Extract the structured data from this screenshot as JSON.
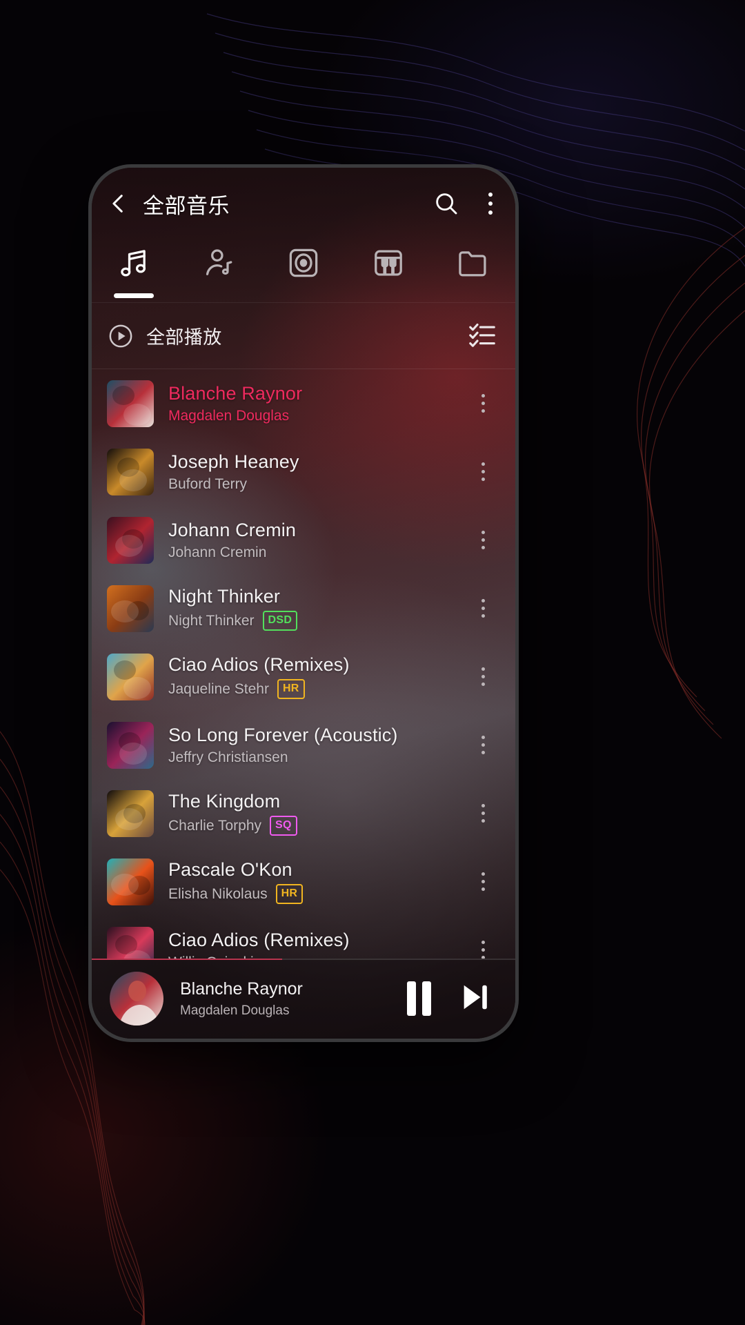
{
  "header": {
    "title": "全部音乐",
    "back_icon": "chevron-left-icon",
    "search_icon": "search-icon",
    "overflow_icon": "overflow-menu-icon"
  },
  "tabs": [
    {
      "name": "songs",
      "icon": "music-note-icon",
      "active": true
    },
    {
      "name": "artists",
      "icon": "artist-icon",
      "active": false
    },
    {
      "name": "albums",
      "icon": "album-disc-icon",
      "active": false
    },
    {
      "name": "genres",
      "icon": "piano-icon",
      "active": false
    },
    {
      "name": "folders",
      "icon": "folder-icon",
      "active": false
    }
  ],
  "play_all": {
    "label": "全部播放",
    "play_icon": "play-circle-icon",
    "multiselect_icon": "checklist-icon"
  },
  "songs": [
    {
      "title": "Blanche Raynor",
      "artist": "Magdalen Douglas",
      "badge": "",
      "playing": true,
      "art": [
        "#1d4f66",
        "#b8303a",
        "#e8e2dc"
      ]
    },
    {
      "title": "Joseph Heaney",
      "artist": "Buford Terry",
      "badge": "",
      "playing": false,
      "art": [
        "#120d0b",
        "#c98a2a",
        "#3a2410"
      ]
    },
    {
      "title": "Johann Cremin",
      "artist": "Johann Cremin",
      "badge": "",
      "playing": false,
      "art": [
        "#3a1020",
        "#b02430",
        "#1e2a58"
      ]
    },
    {
      "title": "Night Thinker",
      "artist": "Night Thinker",
      "badge": "DSD",
      "playing": false,
      "art": [
        "#d2701f",
        "#8a3c14",
        "#2a3a52"
      ]
    },
    {
      "title": "Ciao Adios (Remixes)",
      "artist": "Jaqueline Stehr",
      "badge": "HR",
      "playing": false,
      "art": [
        "#4fa8c8",
        "#e0a44a",
        "#8e2a26"
      ]
    },
    {
      "title": "So Long Forever (Acoustic)",
      "artist": "Jeffry Christiansen",
      "badge": "",
      "playing": false,
      "art": [
        "#1a1030",
        "#9a2458",
        "#2c6a8a"
      ]
    },
    {
      "title": "The Kingdom",
      "artist": "Charlie Torphy",
      "badge": "SQ",
      "playing": false,
      "art": [
        "#0e0a0c",
        "#d8a23a",
        "#6a4a40"
      ]
    },
    {
      "title": "Pascale O'Kon",
      "artist": "Elisha Nikolaus",
      "badge": "HR",
      "playing": false,
      "art": [
        "#20b0b8",
        "#e8521a",
        "#3a1008"
      ]
    },
    {
      "title": "Ciao Adios (Remixes)",
      "artist": "Willis Osinski",
      "badge": "",
      "playing": false,
      "art": [
        "#2a1020",
        "#d83a5a",
        "#1a2a4a"
      ]
    }
  ],
  "mini_player": {
    "title": "Blanche Raynor",
    "artist": "Magdalen Douglas",
    "pause_icon": "pause-icon",
    "next_icon": "skip-next-icon",
    "progress_percent": 45
  },
  "colors": {
    "accent": "#ee2a5e",
    "badge_dsd": "#52e05c",
    "badge_hr": "#f1b520",
    "badge_sq": "#f05bf0"
  }
}
